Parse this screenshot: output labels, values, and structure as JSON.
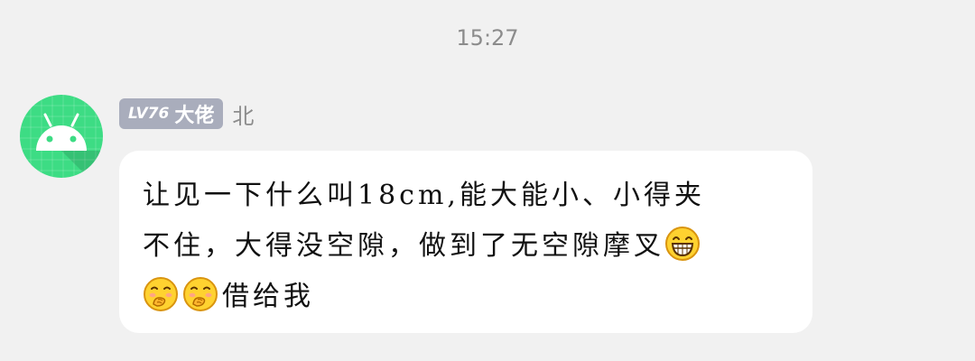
{
  "timestamp": "15:27",
  "sender": {
    "level": "LV76",
    "title": "大佬",
    "name": "北",
    "avatar_icon": "android-robot-icon",
    "avatar_color": "#3ddc84"
  },
  "message": {
    "line1": "让见一下什么叫18cm,能大能小、小得夹",
    "line2": "不住，大得没空隙，做到了无空隙摩叉",
    "line3_text": "借给我",
    "emojis": [
      "grin-emoji-icon",
      "shy-covering-mouth-emoji-icon",
      "shy-covering-mouth-emoji-icon"
    ]
  },
  "colors": {
    "background": "#f1f1f1",
    "bubble": "#ffffff",
    "badge": "#a9adbc",
    "emoji_yellow": "#ffd230"
  }
}
